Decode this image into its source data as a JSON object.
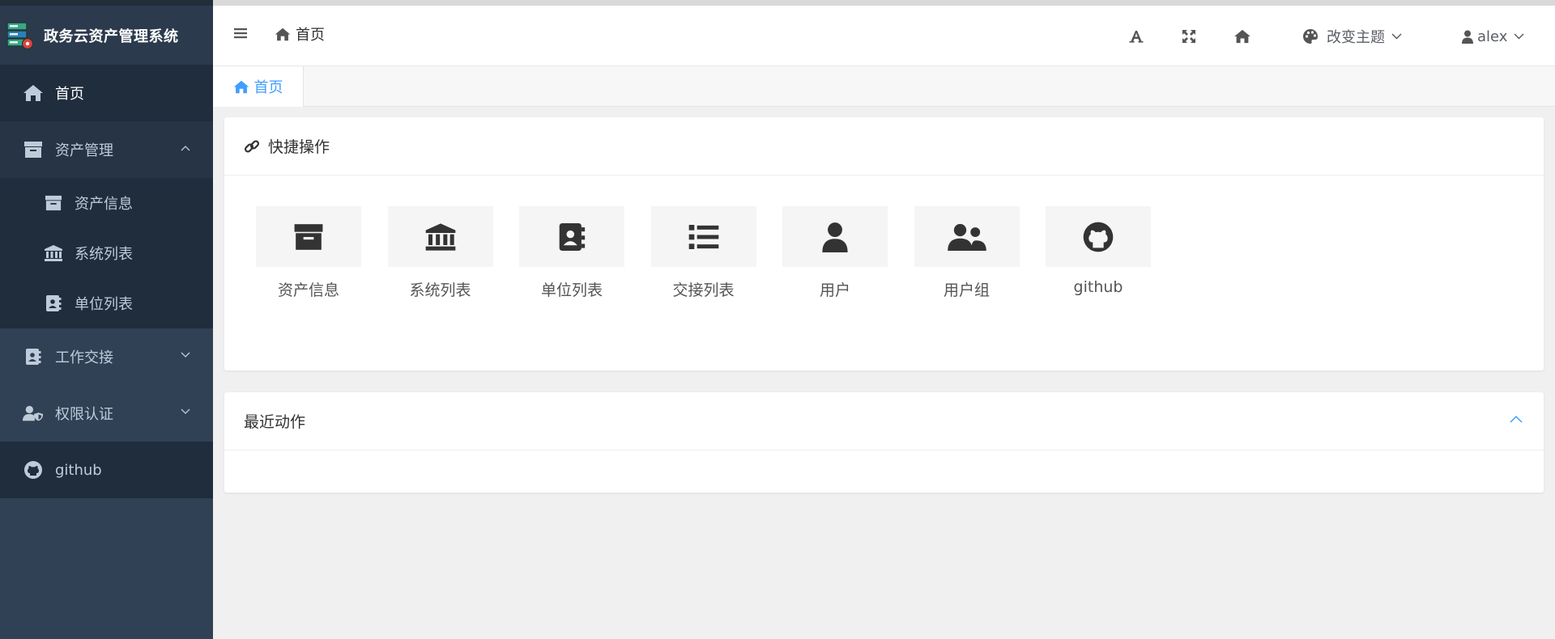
{
  "app": {
    "title": "政务云资产管理系统"
  },
  "sidebar": {
    "home": "首页",
    "asset_mgmt": "资产管理",
    "asset_info": "资产信息",
    "system_list": "系统列表",
    "unit_list": "单位列表",
    "work_handover": "工作交接",
    "auth": "权限认证",
    "github": "github"
  },
  "header": {
    "breadcrumb": "首页",
    "theme_label": "改变主题",
    "user": "alex"
  },
  "tags": {
    "home": "首页"
  },
  "quick": {
    "title": "快捷操作",
    "items": [
      "资产信息",
      "系统列表",
      "单位列表",
      "交接列表",
      "用户",
      "用户组",
      "github"
    ]
  },
  "recent": {
    "title": "最近动作"
  },
  "colors": {
    "sidebar_bg": "#304156",
    "accent": "#409eff"
  }
}
